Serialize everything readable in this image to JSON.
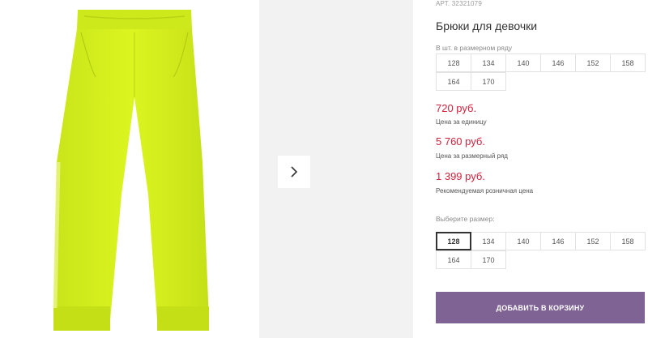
{
  "product": {
    "sku_label": "АРТ.",
    "sku": "32321079",
    "title": "Брюки для девочки"
  },
  "size_range": {
    "caption": "В шт. в размерном ряду",
    "sizes": [
      "128",
      "134",
      "140",
      "146",
      "152",
      "158",
      "164",
      "170"
    ]
  },
  "prices": {
    "unit_price": "720 руб.",
    "unit_label": "Цена за единицу",
    "range_price": "5 760 руб.",
    "range_label": "Цена за размерный ряд",
    "retail_price": "1 399 руб.",
    "retail_label": "Рекомендуемая розничная цена"
  },
  "size_select": {
    "caption": "Выберите размер:",
    "sizes": [
      "128",
      "134",
      "140",
      "146",
      "152",
      "158",
      "164",
      "170"
    ],
    "selected": "128"
  },
  "cart": {
    "button_label": "ДОБАВИТЬ В КОРЗИНУ"
  },
  "colors": {
    "accent": "#7f6394",
    "price": "#d4203b",
    "product": "#d8f21c"
  },
  "icons": {
    "gallery_next": "chevron-right-icon"
  }
}
